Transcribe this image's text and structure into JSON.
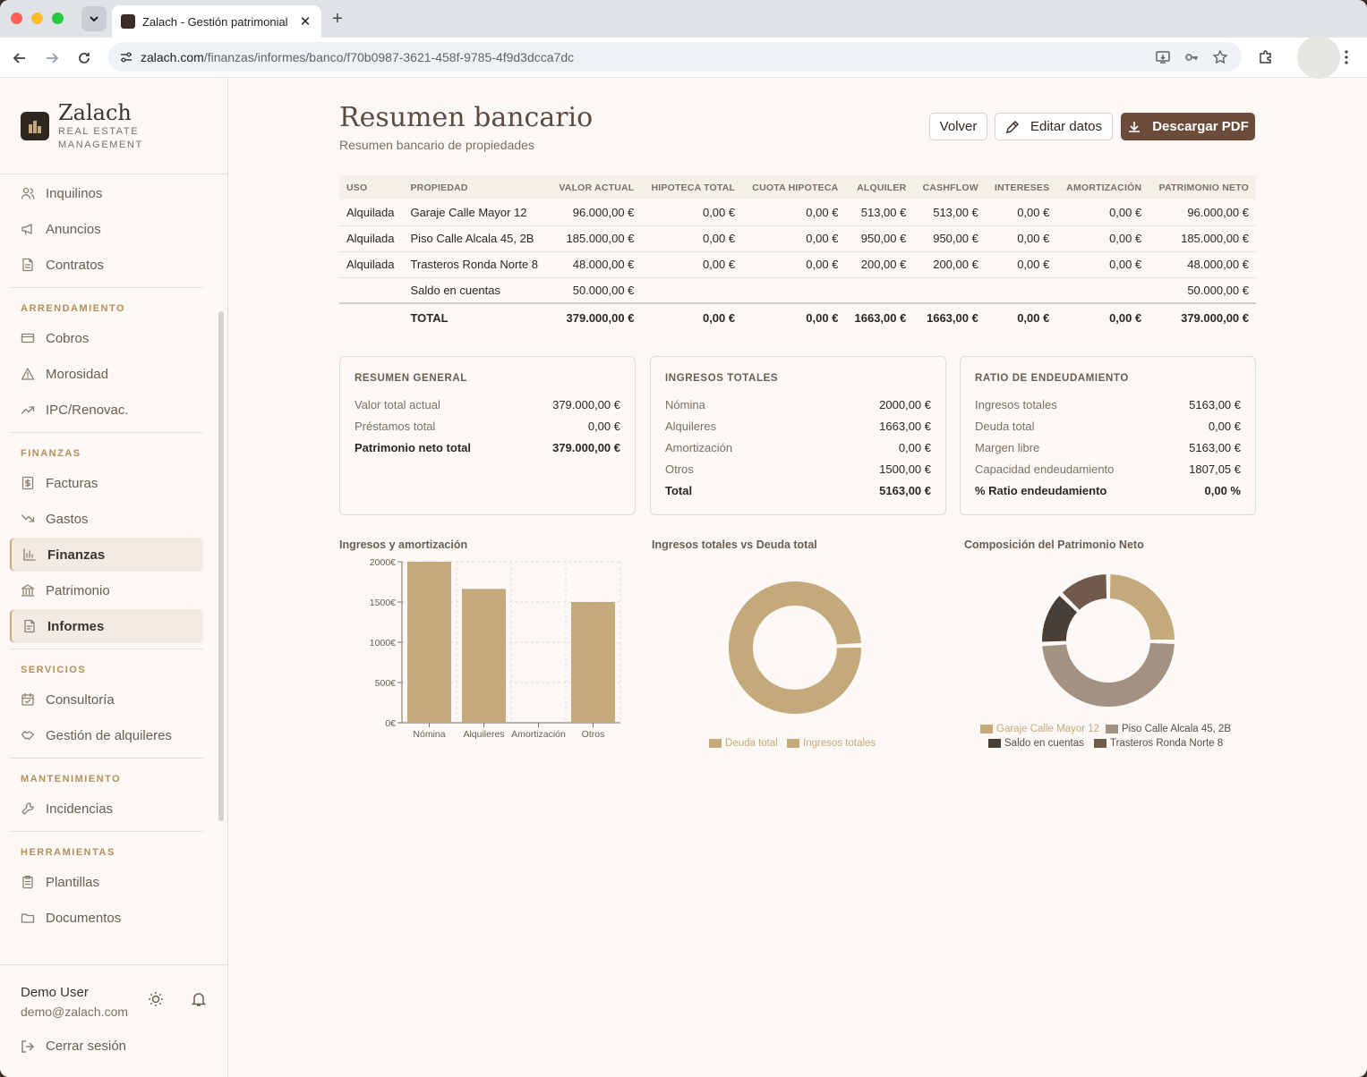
{
  "browser": {
    "tab_title": "Zalach - Gestión patrimonial",
    "url_host": "zalach.com",
    "url_path": "/finanzas/informes/banco/f70b0987-3621-458f-9785-4f9d3dcca7dc"
  },
  "brand": {
    "name": "Zalach",
    "sub1": "REAL ESTATE",
    "sub2": "MANAGEMENT"
  },
  "sidebar": {
    "items_top": [
      {
        "label": "Inquilinos",
        "icon": "users-icon"
      },
      {
        "label": "Anuncios",
        "icon": "megaphone-icon"
      },
      {
        "label": "Contratos",
        "icon": "document-icon"
      }
    ],
    "sections": [
      {
        "title": "ARRENDAMIENTO",
        "items": [
          {
            "label": "Cobros",
            "icon": "credit-card-icon"
          },
          {
            "label": "Morosidad",
            "icon": "warning-icon"
          },
          {
            "label": "IPC/Renovac.",
            "icon": "trending-up-icon"
          }
        ]
      },
      {
        "title": "FINANZAS",
        "items": [
          {
            "label": "Facturas",
            "icon": "invoice-icon"
          },
          {
            "label": "Gastos",
            "icon": "trending-down-icon"
          },
          {
            "label": "Finanzas",
            "icon": "bar-chart-icon",
            "active": true
          },
          {
            "label": "Patrimonio",
            "icon": "bank-icon"
          },
          {
            "label": "Informes",
            "icon": "report-icon",
            "active": true
          }
        ]
      },
      {
        "title": "SERVICIOS",
        "items": [
          {
            "label": "Consultoría",
            "icon": "calendar-check-icon"
          },
          {
            "label": "Gestión de alquileres",
            "icon": "handshake-icon"
          }
        ]
      },
      {
        "title": "MANTENIMIENTO",
        "items": [
          {
            "label": "Incidencias",
            "icon": "wrench-icon"
          }
        ]
      },
      {
        "title": "HERRAMIENTAS",
        "items": [
          {
            "label": "Plantillas",
            "icon": "clipboard-icon"
          },
          {
            "label": "Documentos",
            "icon": "folder-icon"
          }
        ]
      }
    ],
    "user": {
      "name": "Demo User",
      "email": "demo@zalach.com"
    },
    "logout_label": "Cerrar sesión"
  },
  "page": {
    "title": "Resumen bancario",
    "subtitle": "Resumen bancario de propiedades",
    "buttons": {
      "back": "Volver",
      "edit": "Editar datos",
      "download": "Descargar PDF"
    }
  },
  "table": {
    "headers": [
      "USO",
      "PROPIEDAD",
      "VALOR ACTUAL",
      "HIPOTECA TOTAL",
      "CUOTA HIPOTECA",
      "ALQUILER",
      "CASHFLOW",
      "INTERESES",
      "AMORTIZACIÓN",
      "PATRIMONIO NETO"
    ],
    "rows": [
      [
        "Alquilada",
        "Garaje Calle Mayor 12",
        "96.000,00 €",
        "0,00 €",
        "0,00 €",
        "513,00 €",
        "513,00 €",
        "0,00 €",
        "0,00 €",
        "96.000,00 €"
      ],
      [
        "Alquilada",
        "Piso Calle Alcala 45, 2B",
        "185.000,00 €",
        "0,00 €",
        "0,00 €",
        "950,00 €",
        "950,00 €",
        "0,00 €",
        "0,00 €",
        "185.000,00 €"
      ],
      [
        "Alquilada",
        "Trasteros Ronda Norte 8",
        "48.000,00 €",
        "0,00 €",
        "0,00 €",
        "200,00 €",
        "200,00 €",
        "0,00 €",
        "0,00 €",
        "48.000,00 €"
      ],
      [
        "",
        "Saldo en cuentas",
        "50.000,00 €",
        "",
        "",
        "",
        "",
        "",
        "",
        "50.000,00 €"
      ]
    ],
    "total": [
      "",
      "TOTAL",
      "379.000,00 €",
      "0,00 €",
      "0,00 €",
      "1663,00 €",
      "1663,00 €",
      "0,00 €",
      "0,00 €",
      "379.000,00 €"
    ]
  },
  "cards": [
    {
      "title": "RESUMEN GENERAL",
      "rows": [
        {
          "k": "Valor total actual",
          "v": "379.000,00 €"
        },
        {
          "k": "Préstamos total",
          "v": "0,00 €"
        },
        {
          "k": "Patrimonio neto total",
          "v": "379.000,00 €",
          "bold": true
        }
      ]
    },
    {
      "title": "INGRESOS TOTALES",
      "rows": [
        {
          "k": "Nómina",
          "v": "2000,00 €"
        },
        {
          "k": "Alquileres",
          "v": "1663,00 €"
        },
        {
          "k": "Amortización",
          "v": "0,00 €"
        },
        {
          "k": "Otros",
          "v": "1500,00 €"
        },
        {
          "k": "Total",
          "v": "5163,00 €",
          "bold": true
        }
      ]
    },
    {
      "title": "RATIO DE ENDEUDAMIENTO",
      "rows": [
        {
          "k": "Ingresos totales",
          "v": "5163,00 €"
        },
        {
          "k": "Deuda total",
          "v": "0,00 €"
        },
        {
          "k": "Margen libre",
          "v": "5163,00 €"
        },
        {
          "k": "Capacidad endeudamiento",
          "v": "1807,05 €"
        },
        {
          "k": "% Ratio endeudamiento",
          "v": "0,00 %",
          "bold": true
        }
      ]
    }
  ],
  "chart_data": [
    {
      "type": "bar",
      "title": "Ingresos y amortización",
      "categories": [
        "Nómina",
        "Alquileres",
        "Amortización",
        "Otros"
      ],
      "values": [
        2000,
        1663,
        0,
        1500
      ],
      "ylim": [
        0,
        2000
      ],
      "yticks": [
        "0€",
        "500€",
        "1000€",
        "1500€",
        "2000€"
      ],
      "yticks_values": [
        0,
        500,
        1000,
        1500,
        2000
      ],
      "grid": true,
      "color": "#c4a97b"
    },
    {
      "type": "pie",
      "title": "Ingresos totales vs Deuda total",
      "labels": [
        "Deuda total",
        "Ingresos totales"
      ],
      "values": [
        0,
        5163
      ],
      "colors": [
        "#c4a97b",
        "#c4a97b"
      ],
      "legend": "bottom"
    },
    {
      "type": "pie",
      "title": "Composición del Patrimonio Neto",
      "labels": [
        "Garaje Calle Mayor 12",
        "Piso Calle Alcala 45, 2B",
        "Saldo en cuentas",
        "Trasteros Ronda Norte 8"
      ],
      "values": [
        96000,
        185000,
        50000,
        48000
      ],
      "colors": [
        "#c4a97b",
        "#a39182",
        "#4a3f36",
        "#6f5a4b"
      ],
      "legend": "bottom"
    }
  ]
}
